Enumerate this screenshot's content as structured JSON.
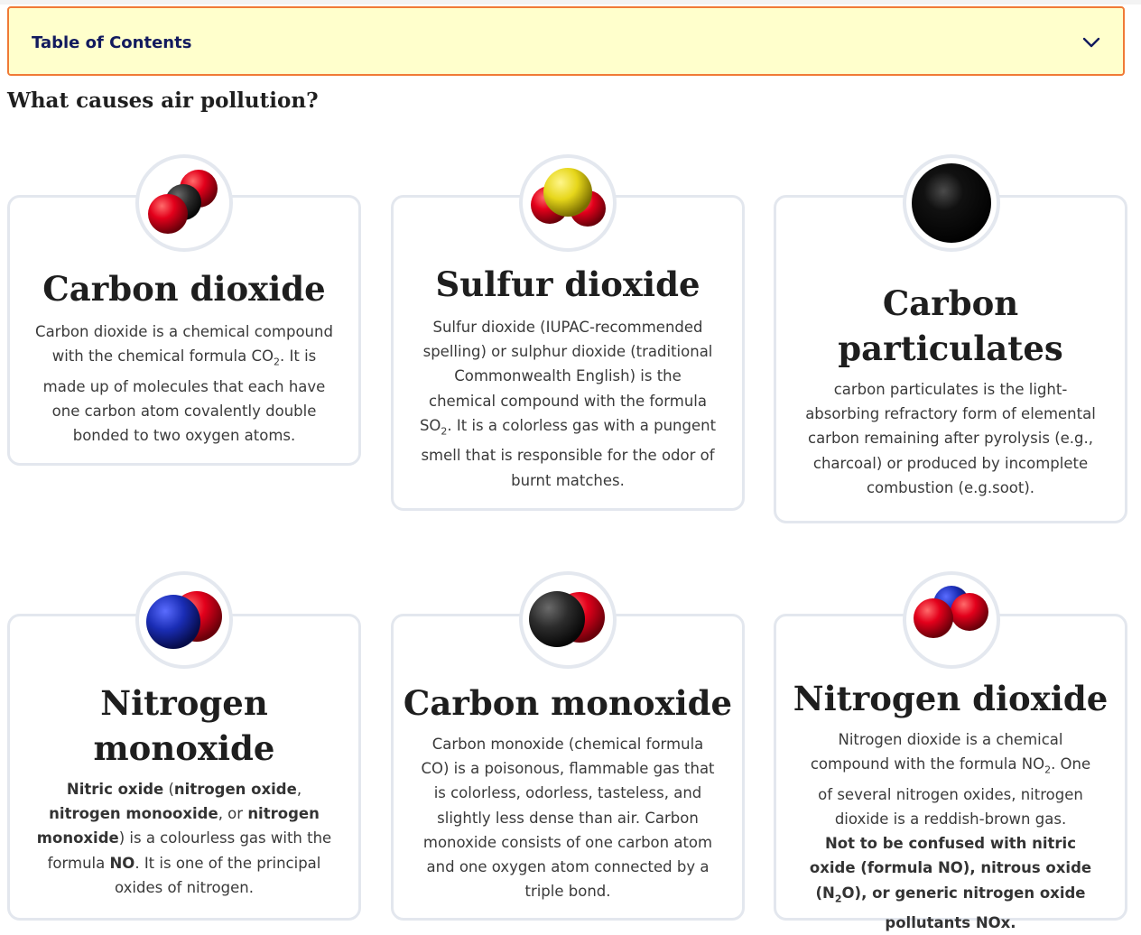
{
  "toc": {
    "title": "Table of Contents",
    "chevron_icon": "chevron-down-icon"
  },
  "section": {
    "heading": "What causes air pollution?"
  },
  "cards": [
    {
      "title": "Carbon dioxide",
      "icon": "carbon-dioxide-molecule-icon",
      "desc": [
        {
          "t": "Carbon dioxide is a chemical compound with the chemical formula CO"
        },
        {
          "t": "2",
          "sub": true
        },
        {
          "t": ". It is made up of molecules that each have one carbon atom covalently double bonded to two oxygen atoms."
        }
      ]
    },
    {
      "title": "Sulfur dioxide",
      "icon": "sulfur-dioxide-molecule-icon",
      "desc": [
        {
          "t": "Sulfur dioxide (IUPAC-recommended spelling) or sulphur dioxide (traditional Commonwealth English) is the chemical compound with the formula SO"
        },
        {
          "t": "2",
          "sub": true
        },
        {
          "t": ". It is a colorless gas with a pungent smell that is responsible for the odor of burnt matches."
        }
      ]
    },
    {
      "title": "Carbon particulates",
      "icon": "carbon-particulate-icon",
      "desc": [
        {
          "t": "carbon particulates is the light-absorbing refractory form of elemental carbon remaining after pyrolysis (e.g., charcoal) or produced by incomplete combustion (e.g.soot)."
        }
      ]
    },
    {
      "title": "Nitrogen monoxide",
      "icon": "nitrogen-monoxide-molecule-icon",
      "desc": [
        {
          "t": "Nitric oxide",
          "b": true
        },
        {
          "t": " ("
        },
        {
          "t": "nitrogen oxide",
          "b": true
        },
        {
          "t": ", "
        },
        {
          "t": "nitrogen monooxide",
          "b": true
        },
        {
          "t": ", or "
        },
        {
          "t": "nitrogen monoxide",
          "b": true
        },
        {
          "t": ") is a colourless gas with the formula "
        },
        {
          "t": "NO",
          "b": true
        },
        {
          "t": ". It is one of the principal oxides of nitrogen."
        }
      ]
    },
    {
      "title": "Carbon monoxide",
      "icon": "carbon-monoxide-molecule-icon",
      "desc": [
        {
          "t": "Carbon monoxide (chemical formula CO) is a poisonous, flammable gas that is colorless, odorless, tasteless, and slightly less dense than air. Carbon monoxide consists of one carbon atom and one oxygen atom connected by a triple bond."
        }
      ]
    },
    {
      "title": "Nitrogen dioxide",
      "icon": "nitrogen-dioxide-molecule-icon",
      "desc": [
        {
          "t": "Nitrogen dioxide is a chemical compound with the formula NO"
        },
        {
          "t": "2",
          "sub": true
        },
        {
          "t": ". One of several nitrogen oxides, nitrogen dioxide is a reddish-brown gas."
        },
        {
          "t": "Not to be confused with nitric oxide (formula NO), nitrous oxide (N",
          "b": true,
          "br": true
        },
        {
          "t": "2",
          "sub": true,
          "b": true
        },
        {
          "t": "O), or generic nitrogen oxide pollutants NOx.",
          "b": true
        }
      ]
    }
  ]
}
